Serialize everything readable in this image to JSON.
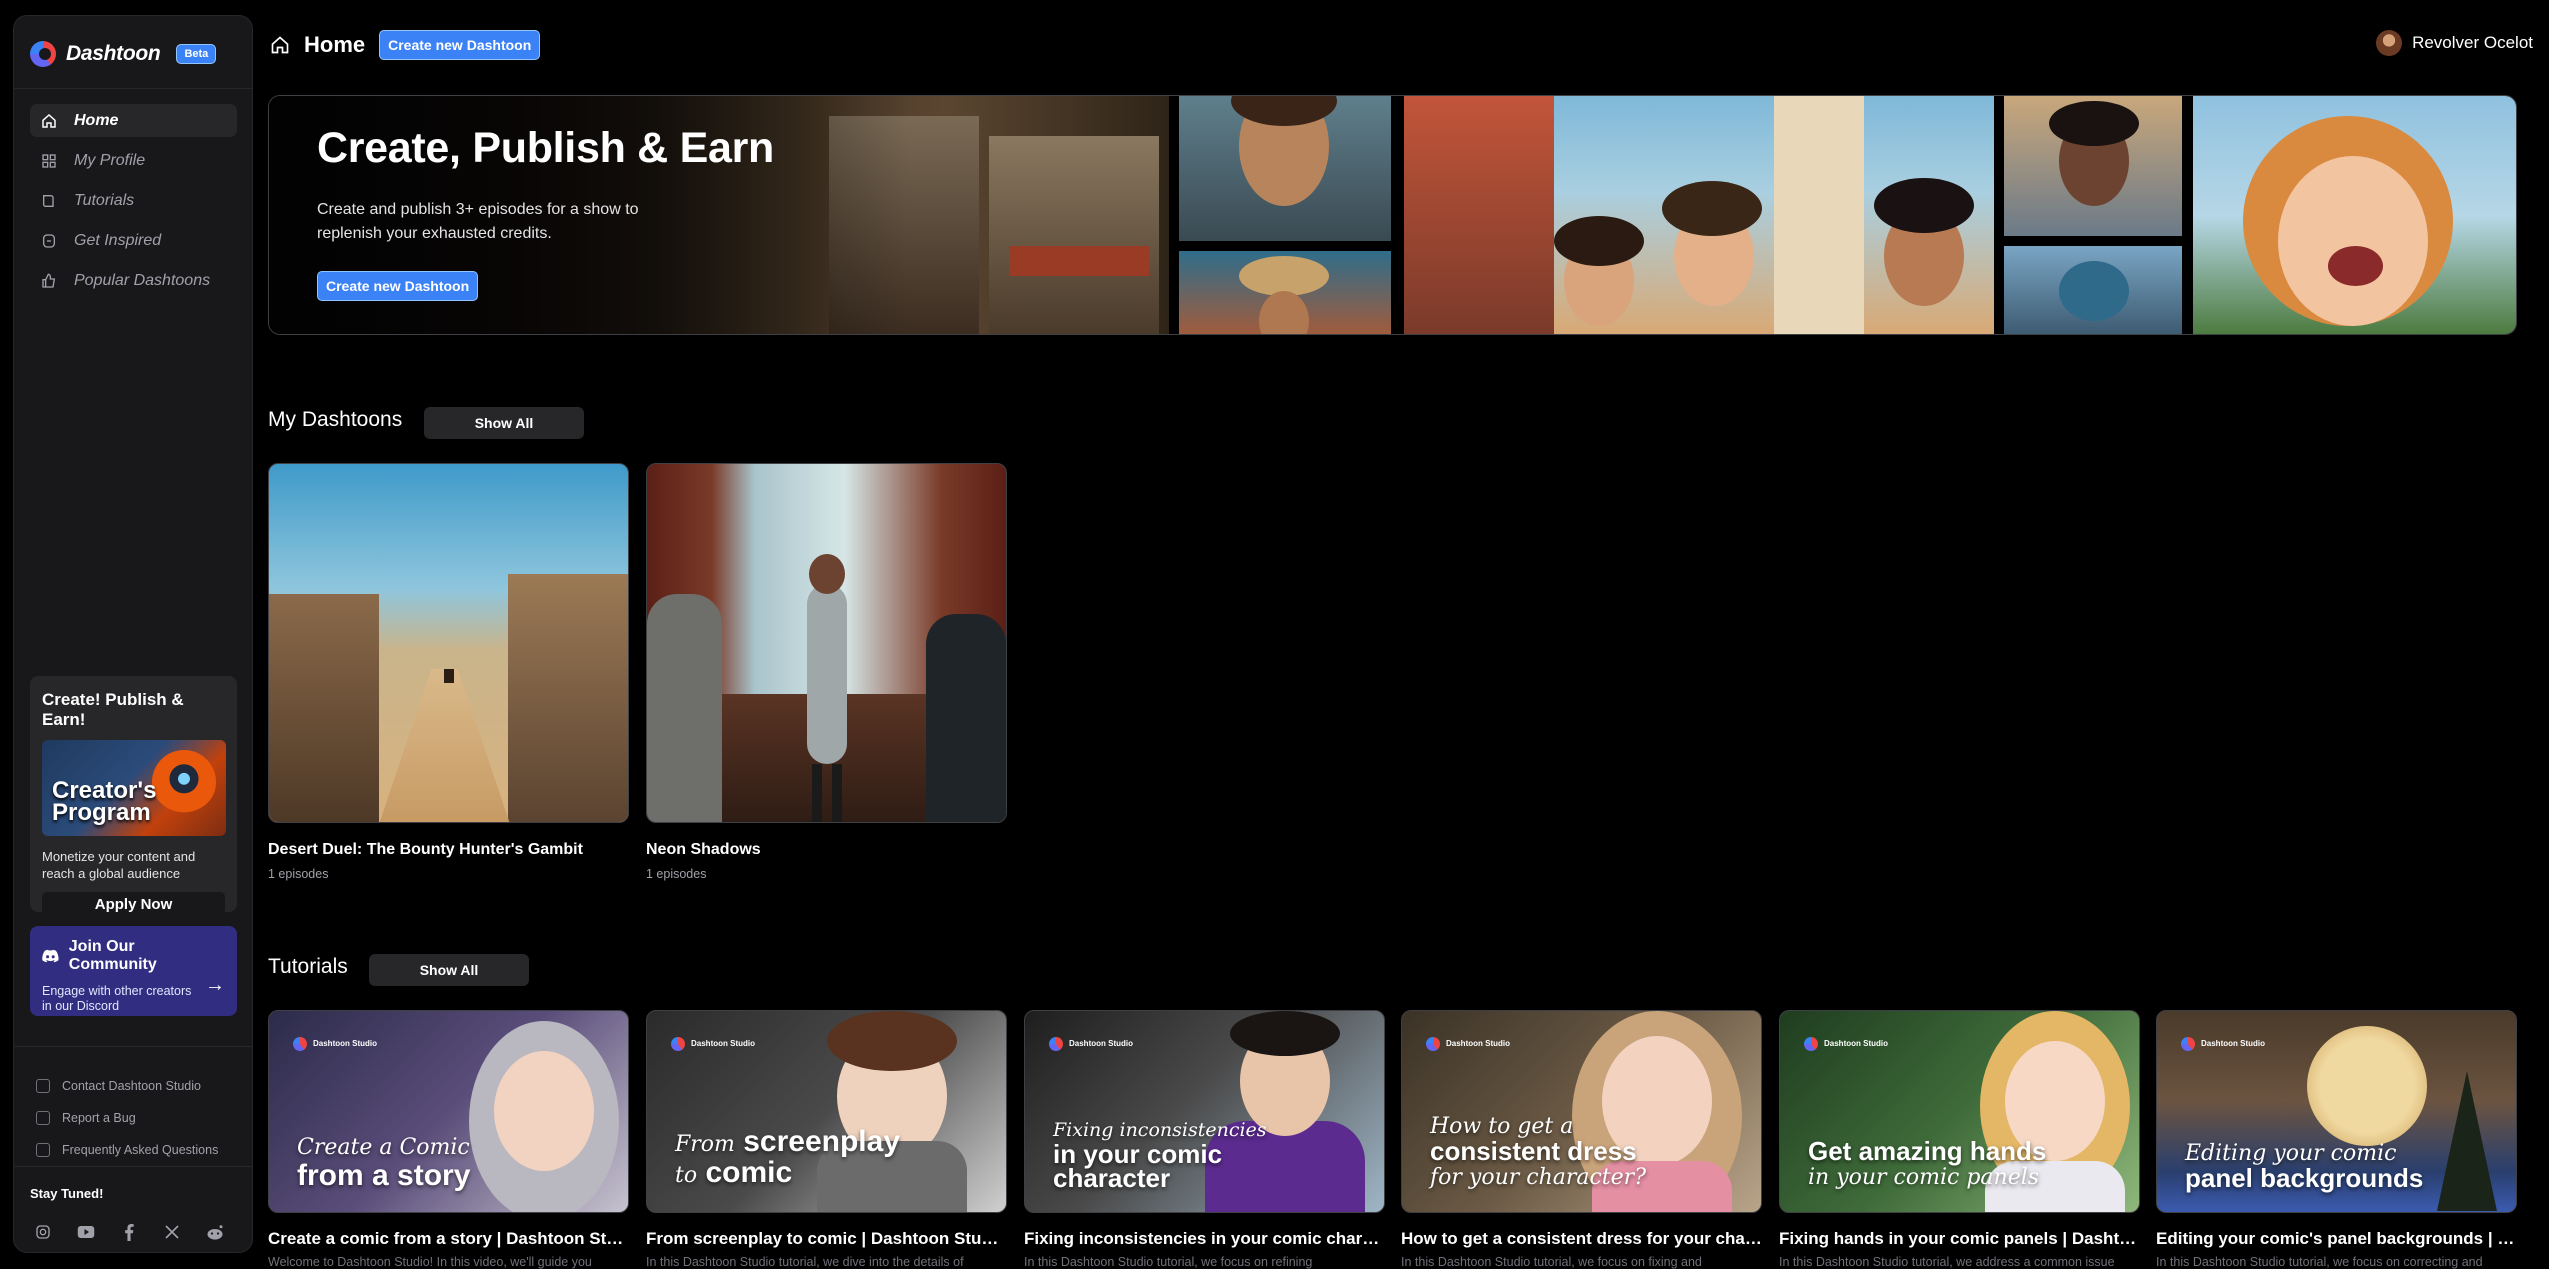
{
  "brand": {
    "name": "Dashtoon",
    "badge": "Beta"
  },
  "sidebar": {
    "nav": [
      {
        "label": "Home",
        "icon": "home-icon",
        "active": true
      },
      {
        "label": "My Profile",
        "icon": "grid-icon"
      },
      {
        "label": "Tutorials",
        "icon": "book-icon"
      },
      {
        "label": "Get Inspired",
        "icon": "bulb-icon"
      },
      {
        "label": "Popular Dashtoons",
        "icon": "thumbs-up-icon"
      }
    ],
    "promo": {
      "title": "Create! Publish & Earn!",
      "image_text": "Creator's Program",
      "description": "Monetize your content and reach a global audience",
      "button": "Apply Now"
    },
    "community": {
      "title": "Join Our Community",
      "description": "Engage with other creators in our Discord"
    },
    "links": [
      "Contact Dashtoon Studio",
      "Report a Bug",
      "Frequently Asked Questions"
    ],
    "stay_tuned": "Stay Tuned!",
    "socials": [
      "instagram-icon",
      "youtube-icon",
      "facebook-icon",
      "x-icon",
      "reddit-icon"
    ]
  },
  "header": {
    "title": "Home",
    "create_button": "Create new Dashtoon",
    "user_name": "Revolver Ocelot"
  },
  "hero": {
    "title": "Create, Publish & Earn",
    "description": "Create and publish 3+ episodes for a show to replenish your exhausted credits.",
    "button": "Create new Dashtoon"
  },
  "my_dashtoons": {
    "title": "My Dashtoons",
    "show_all": "Show All",
    "items": [
      {
        "title": "Desert Duel: The Bounty Hunter's Gambit",
        "episodes": "1 episodes"
      },
      {
        "title": "Neon Shadows",
        "episodes": "1 episodes"
      }
    ]
  },
  "tutorials": {
    "title": "Tutorials",
    "show_all": "Show All",
    "studio_label": "Dashtoon Studio",
    "items": [
      {
        "title": "Create a comic from a story | Dashtoon Studio Tutorial",
        "desc": "Welcome to Dashtoon Studio! In this video, we'll guide you",
        "thumb_script": "Create a Comic",
        "thumb_bold": "from a story"
      },
      {
        "title": "From screenplay to comic | Dashtoon Studio Tutorial",
        "desc": "In this Dashtoon Studio tutorial, we dive into the details of",
        "thumb_script": "From",
        "thumb_bold": "screenplay",
        "thumb_script2": "to",
        "thumb_bold2": "comic"
      },
      {
        "title": "Fixing inconsistencies in your comic character | Dashtoon Studio",
        "desc": "In this Dashtoon Studio tutorial, we focus on refining",
        "thumb_script": "Fixing inconsistencies",
        "thumb_bold": "in your comic character"
      },
      {
        "title": "How to get a consistent dress for your character | Dashtoon Studio",
        "desc": "In this Dashtoon Studio tutorial, we focus on fixing and",
        "thumb_script": "How to get a",
        "thumb_bold": "consistent dress",
        "thumb_script2": "for your character?"
      },
      {
        "title": "Fixing hands in your comic panels | Dashtoon Studio Tutorial",
        "desc": "In this Dashtoon Studio tutorial, we address a common issue",
        "thumb_bold": "Get amazing hands",
        "thumb_script": "in your comic panels"
      },
      {
        "title": "Editing your comic's panel backgrounds | Dashtoon Studio",
        "desc": "In this Dashtoon Studio tutorial, we focus on correcting and",
        "thumb_script": "Editing your comic",
        "thumb_bold": "panel backgrounds"
      }
    ]
  }
}
